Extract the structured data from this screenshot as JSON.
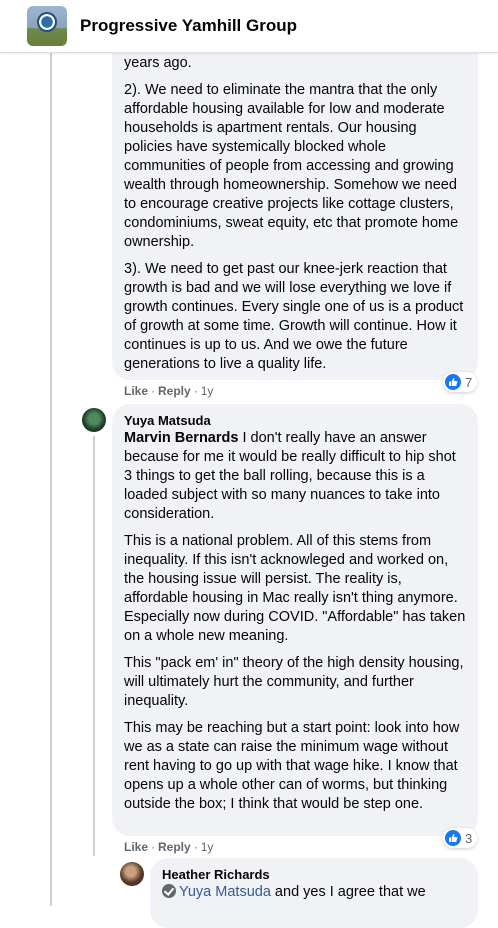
{
  "header": {
    "group_name": "Progressive Yamhill Group"
  },
  "comment1": {
    "partial_text": "years ago.",
    "paragraphs": [
      "2). We need to eliminate the mantra that the only affordable housing available for low and moderate households is apartment rentals. Our housing policies have systemically blocked whole communities of people from accessing and growing wealth through homeownership. Somehow we need to encourage creative projects like cottage clusters, condominiums, sweat equity, etc that promote home ownership.",
      "3). We need to get past our knee-jerk reaction that growth is bad and we will lose everything we love if growth continues. Every single one of us is a product of growth at some time. Growth will continue. How it continues is up to us. And we owe the future generations to live a quality life."
    ],
    "actions": {
      "like": "Like",
      "reply": "Reply",
      "separator": "·",
      "time": "1y"
    },
    "reaction_count": "7"
  },
  "comment2": {
    "author": "Yuya Matsuda",
    "mention": "Marvin Bernards",
    "first_text": " I don't really have an answer because for me it would be really difficult to hip shot 3 things to get the ball rolling, because this is a loaded subject with so many nuances to take into consideration.",
    "paragraphs": [
      "This is a national problem. All of this stems from inequality. If this isn't acknowleged and worked on, the housing issue will persist. The reality is, affordable housing in Mac really isn't thing anymore. Especially now during COVID. \"Affordable\" has taken on a whole new meaning.",
      "This \"pack em' in\" theory of the high density housing, will ultimately hurt the community, and further inequality.",
      "This may be reaching but a start point: look into how we as a state can raise the minimum wage without rent having to go up with that wage hike. I know that opens up a whole other can of worms, but thinking outside the box; I think that would be step one."
    ],
    "actions": {
      "like": "Like",
      "reply": "Reply",
      "separator": "·",
      "time": "1y"
    },
    "reaction_count": "3"
  },
  "comment3": {
    "author": "Heather Richards",
    "mention": "Yuya Matsuda",
    "text": " and yes I agree that we"
  },
  "colors": {
    "bubble": "#f0f2f5",
    "link": "#385898",
    "like_blue": "#1877f2",
    "meta": "#65676b"
  },
  "icons": {
    "like": "thumbs-up-icon",
    "top_contributor": "top-contributor-icon"
  }
}
